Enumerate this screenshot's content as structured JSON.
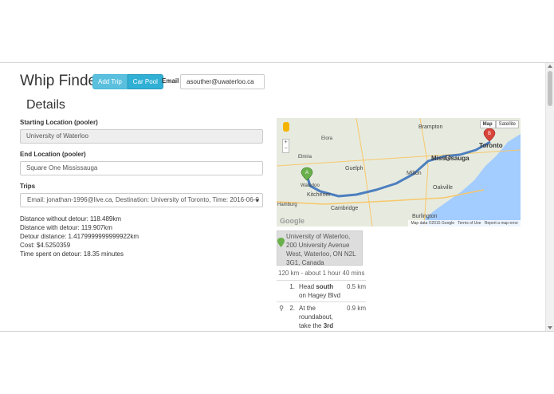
{
  "header": {
    "app_title": "Whip Finder",
    "add_trip_label": "Add Trip",
    "car_pool_label": "Car Pool",
    "email_label": "Email",
    "email_value": "asouther@uwaterloo.ca"
  },
  "details": {
    "section_title": "Details",
    "start_label": "Starting Location (pooler)",
    "start_value": "University of Waterloo",
    "end_label": "End Location (pooler)",
    "end_value": "Square One Mississauga",
    "trips_label": "Trips",
    "trips_selected": "Email: jonathan-1996@live.ca, Destination: University of Toronto, Time: 2016-06-0"
  },
  "stats": {
    "without_detour": "Distance without detour: 118.489km",
    "with_detour": "Distance with detour: 119.907km",
    "detour_distance": "Detour distance: 1.4179999999999922km",
    "cost": "Cost: $4.5250359",
    "time_on_detour": "Time spent on detour: 18.35 minutes"
  },
  "map": {
    "map_button": "Map",
    "satellite_button": "Satellite",
    "zoom_in": "+",
    "zoom_out": "−",
    "footer_data": "Map data ©2015 Google",
    "footer_terms": "Terms of Use",
    "footer_report": "Report a map error",
    "logo": "Google",
    "labels": {
      "brampton": "Brampton",
      "toronto": "Toronto",
      "mississauga": "Mississauga",
      "elora": "Elora",
      "elmira": "Elmira",
      "guelph": "Guelph",
      "waterloo": "Waterloo",
      "kitchener": "Kitchener",
      "milton": "Milton",
      "oakville": "Oakville",
      "cambridge": "Cambridge",
      "hamburg": "Hamburg",
      "burlington": "Burlington"
    },
    "marker_a": "A",
    "marker_b": "B",
    "colors": {
      "land": "#e7ebdf",
      "water": "#a3ccff",
      "route": "#4d7fbf",
      "highway": "#f7c76b",
      "marker_a": "#6ab04c",
      "marker_b": "#d9443a"
    }
  },
  "directions": {
    "start_address": "University of Waterloo, 200 University Avenue West, Waterloo, ON N2L 3G1, Canada",
    "summary": "120 km - about 1 hour 40 mins",
    "steps": [
      {
        "num": "1.",
        "text_pre": "Head ",
        "text_bold": "south",
        "text_post": " on Hagey Blvd",
        "dist": "0.5 km",
        "icon": ""
      },
      {
        "num": "2.",
        "text_pre": "At the roundabout, take the ",
        "text_bold": "3rd",
        "text_post": "",
        "dist": "0.9 km",
        "icon": "roundabout-icon"
      }
    ]
  }
}
